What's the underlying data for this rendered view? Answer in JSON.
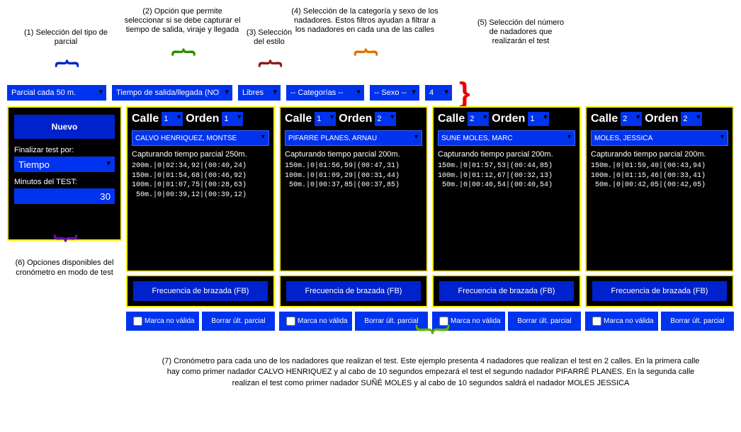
{
  "annotations": {
    "a1": "(1) Selección del tipo de parcial",
    "a2": "(2) Opción que permite seleccionar si se debe capturar el tiempo de salida, viraje y llegada",
    "a3": "(3) Selección del estilo",
    "a4": "(4) Selección de la categoría y sexo de los nadadores. Estos filtros ayudan a filtrar a los nadadores en cada una de las calles",
    "a5": "(5) Selección del número de nadadores que realizarán el test",
    "a6": "(6) Opciones disponibles del cronómetro en modo de test",
    "a7": "(7) Cronómetro para cada uno de los nadadores que realizan el test. Este ejemplo presenta 4 nadadores que realizan el test en 2 calles. En la primera calle hay como primer nadador CALVO HENRIQUEZ y al cabo de 10 segundos empezará el test el segundo nadador PIFARRÉ PLANES. En la segunda calle realizan el test como primer nadador SUÑÉ MOLES y al cabo de 10 segundos saldrá el nadador MOLES JESSICA"
  },
  "filters": {
    "parcial": "Parcial cada 50 m.",
    "salida_llegada": "Tiempo de salida/llegada (NO)",
    "estilo": "Libres",
    "categoria": "-- Categorías --",
    "sexo": "-- Sexo --",
    "num_nadadores": "4"
  },
  "left": {
    "nuevo": "Nuevo",
    "finalizar_por_label": "Finalizar test por:",
    "finalizar_por": "Tiempo",
    "minutos_label": "Minutos del TEST:",
    "minutos": "30"
  },
  "labels": {
    "calle": "Calle",
    "orden": "Orden",
    "fb": "Frecuencia de brazada (FB)",
    "marca_no_valida": "Marca no válida",
    "borrar": "Borrar últ. parcial"
  },
  "lanes": [
    {
      "calle": "1",
      "orden": "1",
      "swimmer": "CALVO HENRIQUEZ, MONTSE",
      "cap": "Capturando tiempo parcial 250m.",
      "splits": "200m.|0|02:34,92|(00:40,24)\n150m.|0|01:54,68|(00:46,92)\n100m.|0|01:07,75|(00:28,63)\n 50m.|0|00:39,12|(00:39,12)"
    },
    {
      "calle": "1",
      "orden": "2",
      "swimmer": "PIFARRÉ PLANES, ARNAU",
      "cap": "Capturando tiempo parcial 200m.",
      "splits": "150m.|0|01:56,59|(00:47,31)\n100m.|0|01:09,29|(00:31,44)\n 50m.|0|00:37,85|(00:37,85)"
    },
    {
      "calle": "2",
      "orden": "1",
      "swimmer": "SUÑÉ MOLES, MARC",
      "cap": "Capturando tiempo parcial 200m.",
      "splits": "150m.|0|01:57,53|(00:44,85)\n100m.|0|01:12,67|(00:32,13)\n 50m.|0|00:40,54|(00:40,54)"
    },
    {
      "calle": "2",
      "orden": "2",
      "swimmer": "MOLES, JESSICA",
      "cap": "Capturando tiempo parcial 200m.",
      "splits": "150m.|0|01:59,40|(00:43,94)\n100m.|0|01:15,46|(00:33,41)\n 50m.|0|00:42,05|(00:42,05)"
    }
  ]
}
